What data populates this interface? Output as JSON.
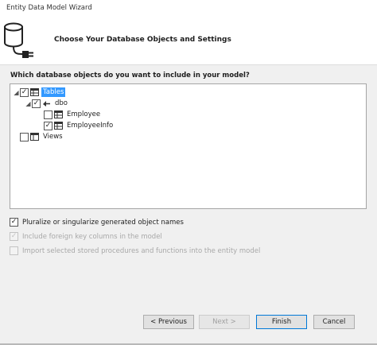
{
  "window": {
    "title": "Entity Data Model Wizard"
  },
  "header": {
    "heading": "Choose Your Database Objects and Settings"
  },
  "main": {
    "question": "Which database objects do you want to include in your model?",
    "tree": {
      "tables": {
        "label": "Tables",
        "checked": true,
        "expanded": true,
        "selected": true
      },
      "dbo": {
        "label": "dbo",
        "checked": true,
        "expanded": true
      },
      "employee": {
        "label": "Employee",
        "checked": false
      },
      "employee_info": {
        "label": "EmployeeInfo",
        "checked": true
      },
      "views": {
        "label": "Views",
        "checked": false,
        "expanded": false
      }
    },
    "options": {
      "pluralize": {
        "label": "Pluralize or singularize generated object names",
        "checked": true,
        "enabled": true
      },
      "foreign_keys": {
        "label": "Include foreign key columns in the model",
        "checked": true,
        "enabled": false
      },
      "stored_procs": {
        "label": "Import selected stored procedures and functions into the entity model",
        "checked": false,
        "enabled": false
      }
    }
  },
  "buttons": {
    "previous": "< Previous",
    "next": "Next >",
    "finish": "Finish",
    "cancel": "Cancel"
  },
  "colors": {
    "selection": "#3399ff",
    "focus_border": "#0078d7"
  }
}
